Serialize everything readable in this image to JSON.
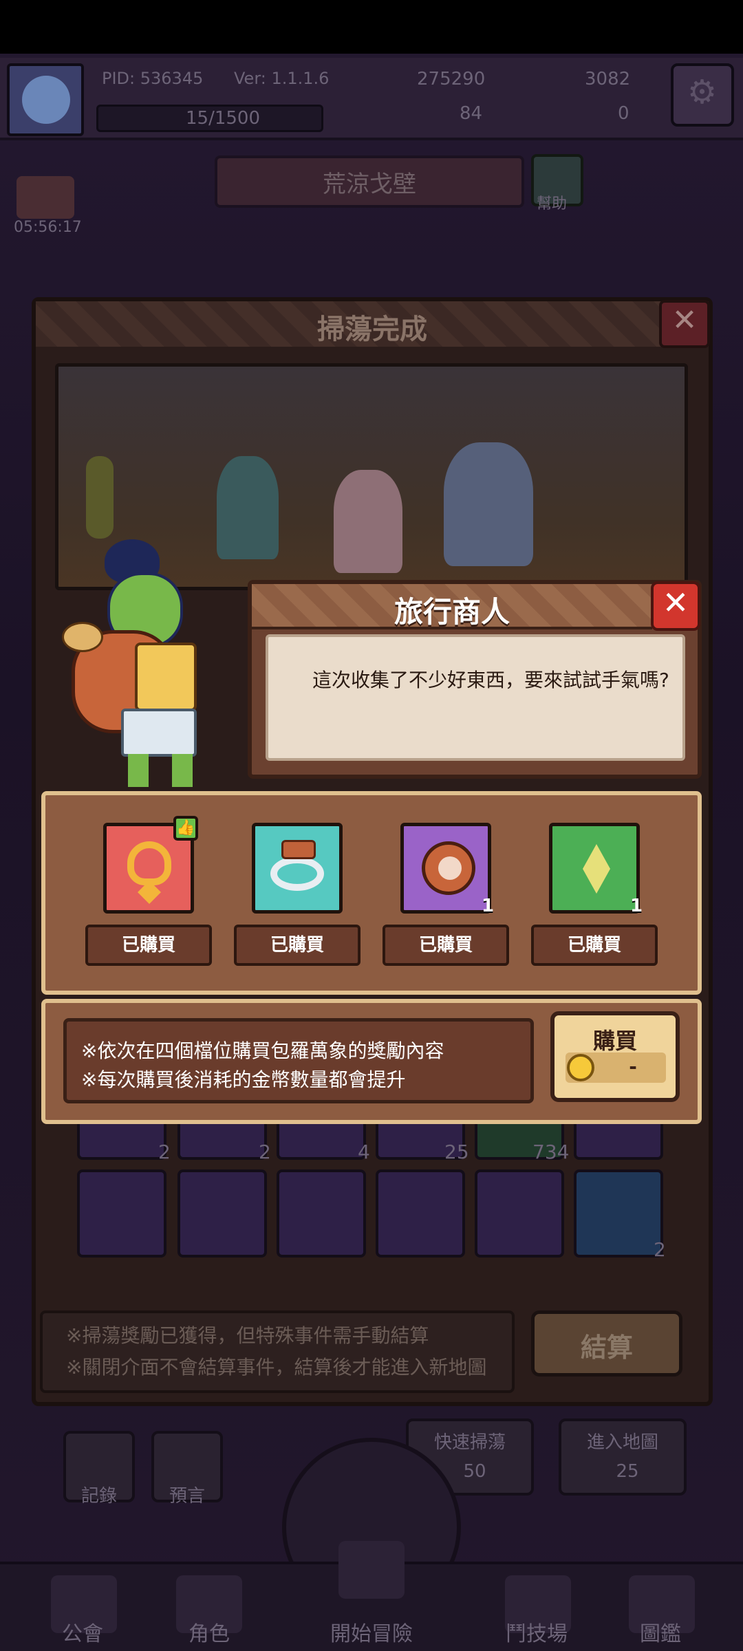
{
  "status": {
    "pid": "PID: 536345",
    "version": "Ver: 1.1.1.6",
    "xp": "15/1500",
    "gold": "275290",
    "gems": "3082",
    "res_green": "84",
    "res_other": "0"
  },
  "map": {
    "title": "荒涼戈壁",
    "help_label": "幫助",
    "timer": "05:56:17"
  },
  "sweep": {
    "title": "掃蕩完成",
    "inventory_counts": [
      "2",
      "2",
      "4",
      "25",
      "734",
      "2"
    ],
    "notes": [
      "※掃蕩獎勵已獲得，但特殊事件需手動結算",
      "※關閉介面不會結算事件，結算後才能進入新地圖"
    ],
    "settle_label": "結算",
    "buttons": {
      "fast_sweep": "快速掃蕩",
      "fast_sweep_cost": "50",
      "enter_map": "進入地圖",
      "enter_map_cost": "25",
      "record": "記錄",
      "preset": "預言"
    }
  },
  "nav": {
    "items": [
      "公會",
      "角色",
      "開始冒險",
      "鬥技場",
      "圖鑑"
    ]
  },
  "merchant": {
    "title": "旅行商人",
    "dialog": "這次收集了不少好東西，要來試試手氣嗎?",
    "slots": [
      {
        "item": "golden-amulet-icon",
        "color": "#e6605c",
        "status": "已購買",
        "count": ""
      },
      {
        "item": "diamond-ring-icon",
        "color": "#56c9c1",
        "status": "已購買",
        "count": ""
      },
      {
        "item": "meat-icon",
        "color": "#9a63c8",
        "status": "已購買",
        "count": "1"
      },
      {
        "item": "yellow-crystal-icon",
        "color": "#4caf55",
        "status": "已購買",
        "count": "1"
      }
    ],
    "info_lines": [
      "※依次在四個檔位購買包羅萬象的獎勵內容",
      "※每次購買後消耗的金幣數量都會提升"
    ],
    "buy_label": "購買",
    "buy_price": "-"
  }
}
